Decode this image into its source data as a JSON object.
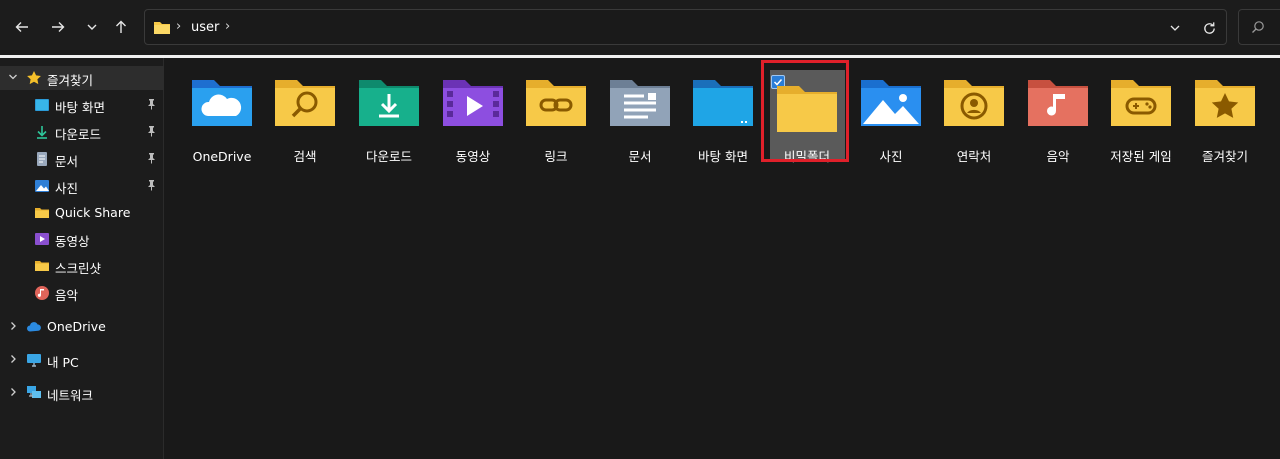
{
  "address": {
    "crumb": "user",
    "separator": "›"
  },
  "sidebar": {
    "items": [
      {
        "label": "즐겨찾기",
        "icon": "star-icon"
      },
      {
        "label": "바탕 화면",
        "icon": "desktop-icon",
        "pinned": true
      },
      {
        "label": "다운로드",
        "icon": "download-icon",
        "pinned": true
      },
      {
        "label": "문서",
        "icon": "document-icon",
        "pinned": true
      },
      {
        "label": "사진",
        "icon": "pictures-icon",
        "pinned": true
      },
      {
        "label": "Quick Share",
        "icon": "folder-icon"
      },
      {
        "label": "동영상",
        "icon": "videos-icon"
      },
      {
        "label": "스크린샷",
        "icon": "folder-icon"
      },
      {
        "label": "음악",
        "icon": "music-icon"
      },
      {
        "label": "OneDrive",
        "icon": "cloud-icon"
      },
      {
        "label": "내 PC",
        "icon": "monitor-icon"
      },
      {
        "label": "네트워크",
        "icon": "network-icon"
      }
    ]
  },
  "folders": [
    {
      "name": "OneDrive",
      "icon": "onedrive-folder-icon"
    },
    {
      "name": "검색",
      "icon": "search-folder-icon"
    },
    {
      "name": "다운로드",
      "icon": "downloads-folder-icon"
    },
    {
      "name": "동영상",
      "icon": "videos-folder-icon"
    },
    {
      "name": "링크",
      "icon": "links-folder-icon"
    },
    {
      "name": "문서",
      "icon": "documents-folder-icon"
    },
    {
      "name": "바탕 화면",
      "icon": "desktop-folder-icon"
    },
    {
      "name": "비밀폴더",
      "icon": "folder-icon",
      "selected": true
    },
    {
      "name": "사진",
      "icon": "pictures-folder-icon"
    },
    {
      "name": "연락처",
      "icon": "contacts-folder-icon"
    },
    {
      "name": "음악",
      "icon": "music-folder-icon"
    },
    {
      "name": "저장된 게임",
      "icon": "saved-games-folder-icon"
    },
    {
      "name": "즐겨찾기",
      "icon": "favorites-folder-icon"
    }
  ],
  "colors": {
    "background": "#191919",
    "selection_outline": "#e0202a",
    "folder_yellow": "#f7c948",
    "accent_blue": "#2a7dd6"
  }
}
